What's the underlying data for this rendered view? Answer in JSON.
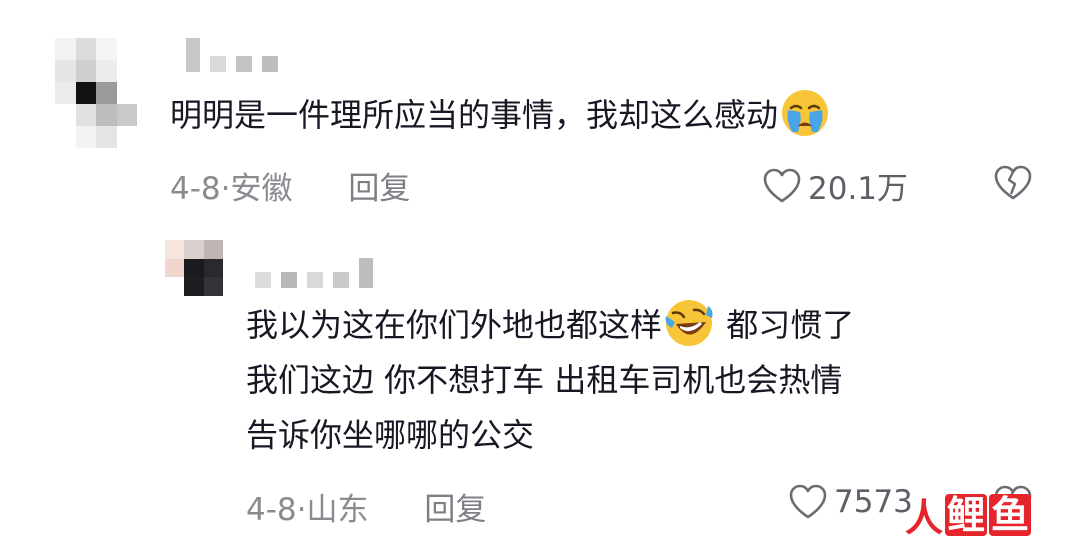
{
  "comment": {
    "text": "明明是一件理所应当的事情，我却这么感动",
    "emoji": "crying-face",
    "date": "4-8·",
    "location": "安徽",
    "reply_label": "回复",
    "like_count": "20.1万"
  },
  "reply": {
    "lines": [
      "我以为这在你们外地也都这样",
      "都习惯了",
      "我们这边 你不想打车 出租车司机也会热情",
      "告诉你坐哪哪的公交"
    ],
    "emoji": "rolling-on-floor-laughing-face",
    "date": "4-8·",
    "location": "山东",
    "reply_label": "回复",
    "like_count": "7573"
  },
  "watermark": {
    "chars": [
      "人",
      "鲤",
      "鱼"
    ]
  },
  "colors": {
    "text": "#161823",
    "meta": "#8a8b91",
    "icon": "#6b6c72",
    "watermark": "#e5252b"
  }
}
